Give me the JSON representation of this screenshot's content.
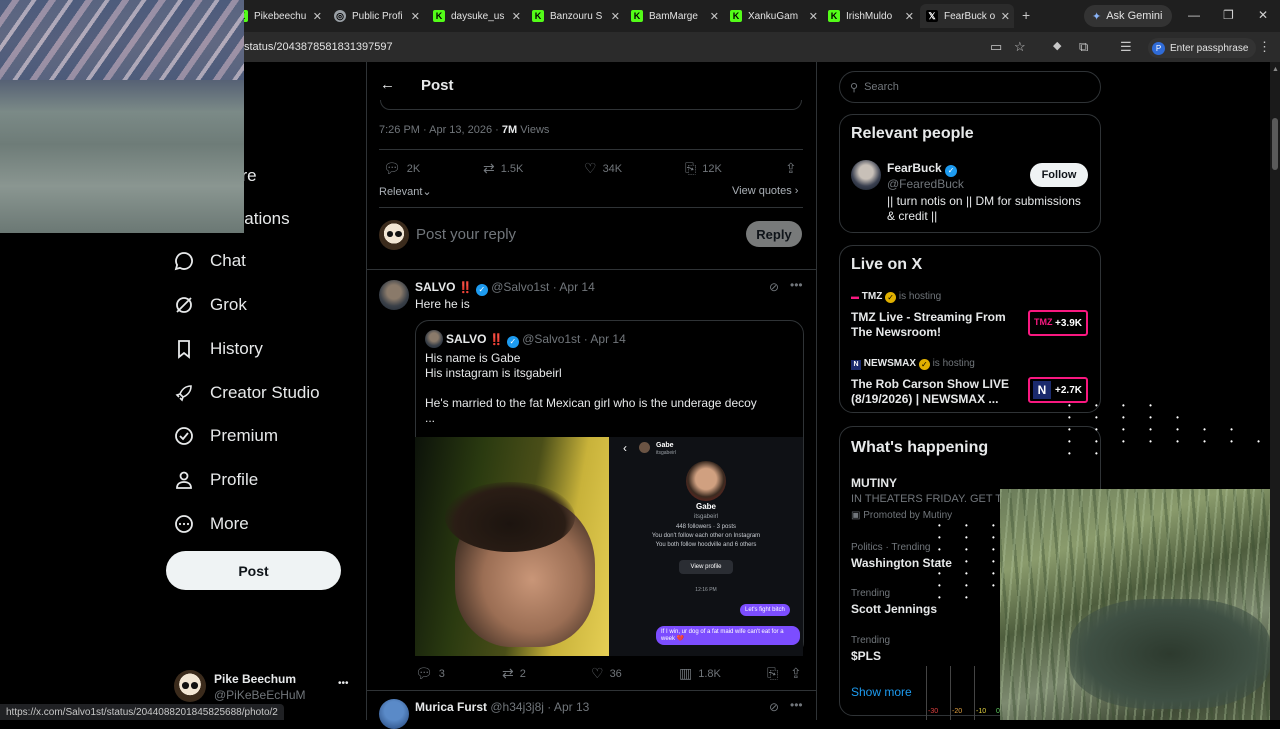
{
  "browser": {
    "tabs": [
      {
        "label": "Pikebeechu",
        "favicon": "kick-icon",
        "color": "#53fc18"
      },
      {
        "label": "Public Profi",
        "favicon": "globe-icon",
        "color": "#9aa0a6"
      },
      {
        "label": "daysuke_us",
        "favicon": "kick-icon",
        "color": "#53fc18"
      },
      {
        "label": "Banzouru S",
        "favicon": "kick-icon",
        "color": "#53fc18"
      },
      {
        "label": "BamMarge",
        "favicon": "kick-icon",
        "color": "#53fc18"
      },
      {
        "label": "XankuGam",
        "favicon": "kick-icon",
        "color": "#53fc18"
      },
      {
        "label": "IrishMuldo",
        "favicon": "kick-icon",
        "color": "#53fc18"
      },
      {
        "label": "FearBuck o",
        "favicon": "x-icon",
        "color": "#ffffff"
      }
    ],
    "new_tab": "+",
    "ask_gemini": "Ask Gemini",
    "url": "status/2043878581831397597",
    "passphrase": "Enter passphrase",
    "passphrase_initial": "P",
    "status_url": "https://x.com/Salvo1st/status/2044088201845825688/photo/2"
  },
  "nav": {
    "partial_items": [
      "e",
      "ore",
      "ications"
    ],
    "items": [
      {
        "label": "Chat",
        "icon": "chat-icon"
      },
      {
        "label": "Grok",
        "icon": "grok-icon"
      },
      {
        "label": "History",
        "icon": "bookmark-icon"
      },
      {
        "label": "Creator Studio",
        "icon": "rocket-icon"
      },
      {
        "label": "Premium",
        "icon": "verified-badge-icon"
      },
      {
        "label": "Profile",
        "icon": "person-icon"
      },
      {
        "label": "More",
        "icon": "more-circle-icon"
      }
    ],
    "post_button": "Post",
    "account": {
      "name": "Pike Beechum",
      "handle": "@PiKeBeEcHuM",
      "more": "•••"
    }
  },
  "post": {
    "header_title": "Post",
    "timestamp": "7:26 PM · Apr 13, 2026 · ",
    "views_count": "7M",
    "views_label": " Views",
    "stats": {
      "replies": "2K",
      "reposts": "1.5K",
      "likes": "34K",
      "bookmarks": "12K"
    },
    "sort": "Relevant",
    "view_quotes": "View quotes",
    "reply_placeholder": "Post your reply",
    "reply_button": "Reply"
  },
  "reply1": {
    "name": "SALVO",
    "marks": "‼️",
    "handle": "@Salvo1st",
    "date": "· Apr 14",
    "text": "Here he is",
    "quote": {
      "name": "SALVO",
      "marks": "‼️",
      "handle": "@Salvo1st",
      "date": "· Apr 14",
      "line1": "His name is Gabe",
      "line2": "His instagram is itsgabeirl",
      "line3": "He's married to the fat Mexican girl who is the underage decoy",
      "line4": "..."
    },
    "screenshot": {
      "top_name": "Gabe",
      "top_handle": "itsgabeirl",
      "name": "Gabe",
      "handle": "itsgabeirl",
      "stats": "448 followers · 3 posts",
      "mutual1": "You don't follow each other on Instagram",
      "mutual2": "You both follow hoodville and 6 others",
      "view_profile": "View profile",
      "time": "12:16 PM",
      "msg1": "Let's fight bitch",
      "msg2": "If I win, ur dog of a fat maid wife can't eat for a week 💔"
    },
    "stats": {
      "replies": "3",
      "reposts": "2",
      "likes": "36",
      "views": "1.8K"
    }
  },
  "reply2": {
    "name": "Murica Furst",
    "handle": "@h34j3j8j",
    "date": "· Apr 13"
  },
  "right": {
    "search_placeholder": "Search",
    "relevant_title": "Relevant people",
    "person": {
      "name": "FearBuck",
      "handle": "@FearedBuck",
      "bio": "|| turn notis on || DM for submissions & credit ||",
      "follow": "Follow"
    },
    "live_title": "Live on X",
    "live": [
      {
        "host": "TMZ",
        "hosting": "is hosting",
        "title": "TMZ Live - Streaming From The Newsroom!",
        "count": "+3.9K"
      },
      {
        "host": "NEWSMAX",
        "hosting": "is hosting",
        "title": "The Rob Carson Show LIVE (8/19/2026) | NEWSMAX ...",
        "count": "+2.7K"
      }
    ],
    "happening_title": "What's happening",
    "promo": {
      "name": "MUTINY",
      "line": "IN THEATERS FRIDAY. GET TI",
      "promoted": "Promoted by Mutiny"
    },
    "trends": [
      {
        "context": "Politics · Trending",
        "name": "Washington State"
      },
      {
        "context": "Trending",
        "name": "Scott Jennings"
      },
      {
        "context": "Trending",
        "name": "$PLS"
      }
    ],
    "show_more": "Show more",
    "meter": [
      "-30",
      "-20",
      "-10",
      "0"
    ]
  },
  "colors": {
    "accent": "#1d9bf0",
    "live": "#f91880",
    "bg": "#000000"
  }
}
